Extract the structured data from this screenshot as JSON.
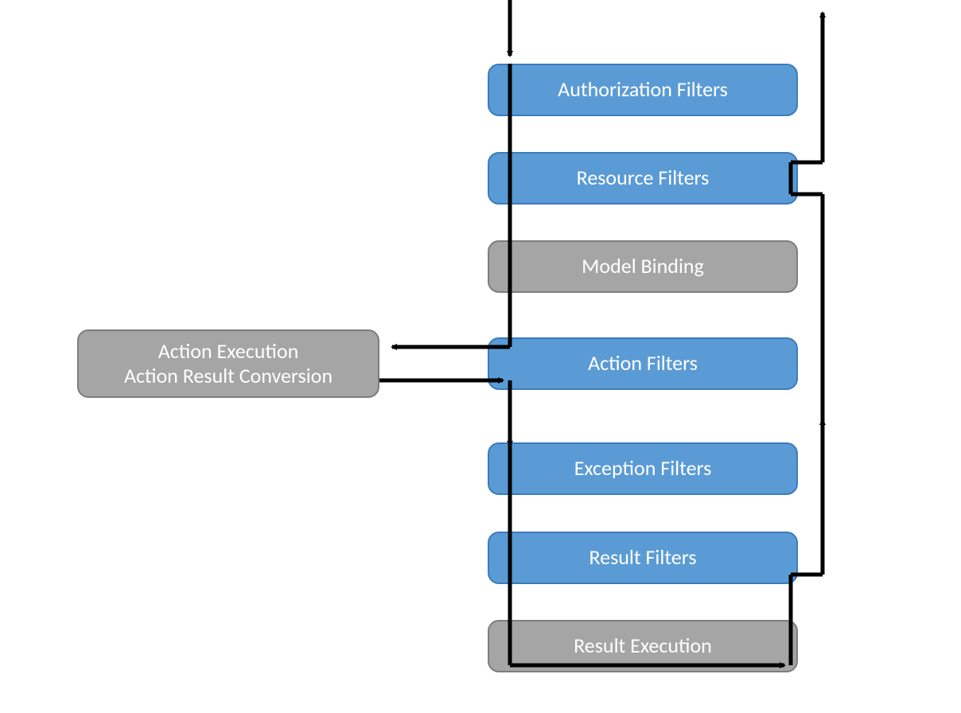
{
  "colors": {
    "blue_fill": "#5b9bd5",
    "blue_border": "#3b7bbf",
    "gray_fill": "#a5a5a5",
    "gray_border": "#7d7d7d",
    "arrow": "#000000"
  },
  "boxes": {
    "authorization_filters": {
      "label": "Authorization Filters",
      "type": "blue"
    },
    "resource_filters": {
      "label": "Resource Filters",
      "type": "blue"
    },
    "model_binding": {
      "label": "Model Binding",
      "type": "gray"
    },
    "action_filters": {
      "label": "Action Filters",
      "type": "blue"
    },
    "exception_filters": {
      "label": "Exception Filters",
      "type": "blue"
    },
    "result_filters": {
      "label": "Result Filters",
      "type": "blue"
    },
    "result_execution": {
      "label": "Result Execution",
      "type": "gray"
    },
    "action_execution": {
      "line1": "Action Execution",
      "line2": "Action Result Conversion",
      "type": "gray"
    }
  }
}
